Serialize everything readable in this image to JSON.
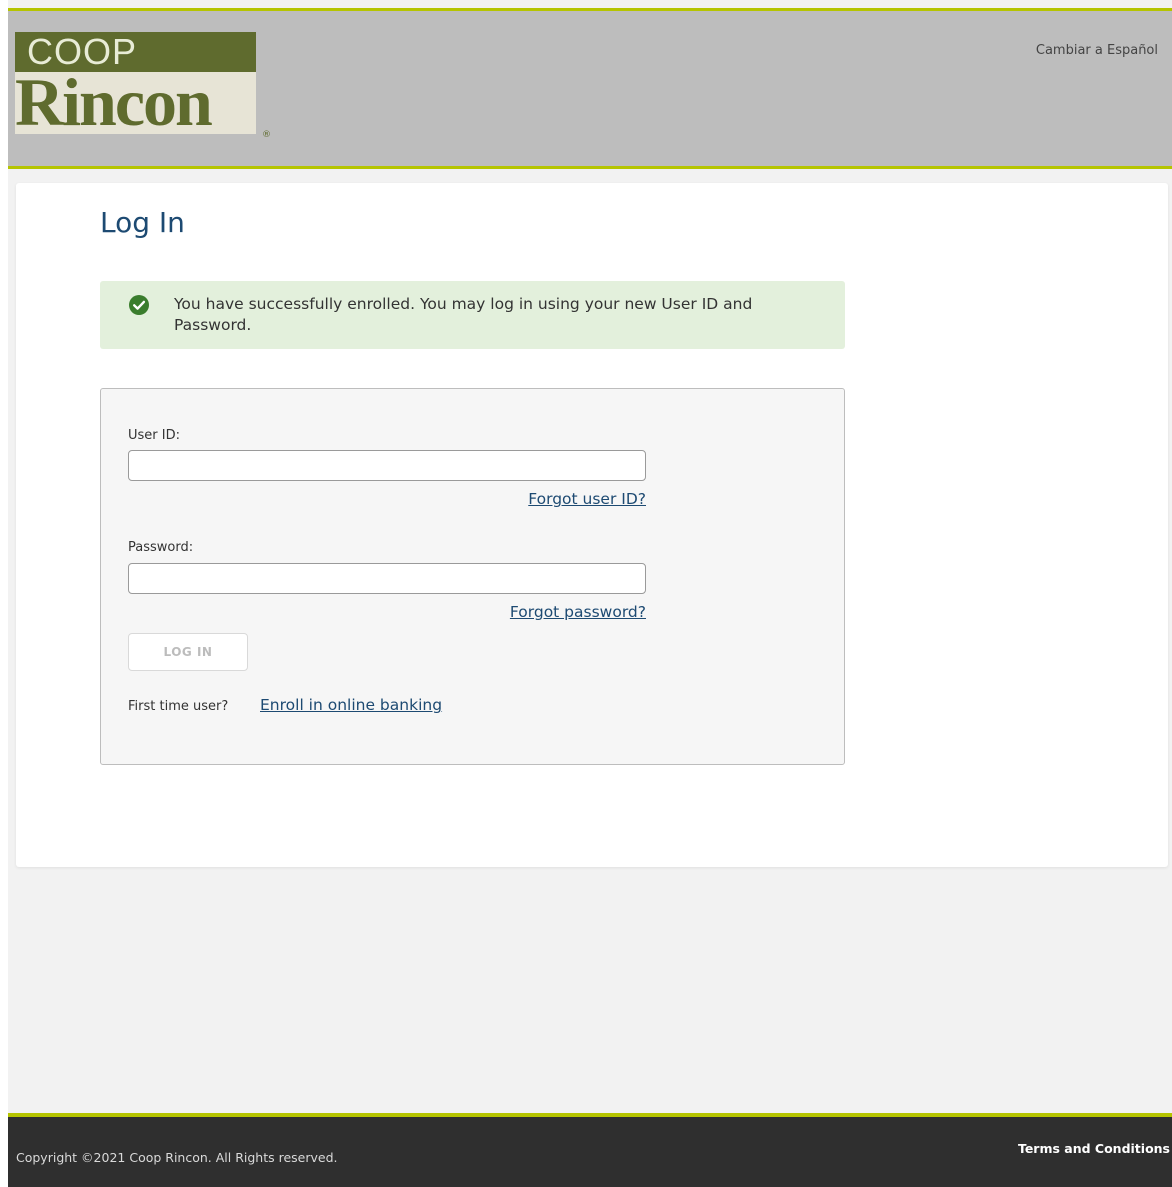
{
  "header": {
    "logo": {
      "top_text": "COOP",
      "bottom_text": "Rincon",
      "registered_mark": "®"
    },
    "language_link": "Cambiar a Español"
  },
  "colors": {
    "accent": "#b5c400",
    "header_bg": "#bdbdbd",
    "logo_green": "#5f6b2e",
    "title_blue": "#1d4a72",
    "success_bg": "#e3f0dc",
    "success_icon": "#3a7d2d",
    "footer_bg": "#2f2f2f"
  },
  "main": {
    "title": "Log In",
    "alert": {
      "icon": "check-circle-icon",
      "message": "You have successfully enrolled. You may log in using your new User ID and Password."
    },
    "login_form": {
      "user_id_label": "User ID:",
      "user_id_value": "",
      "forgot_user_id": "Forgot user ID?",
      "password_label": "Password:",
      "password_value": "",
      "forgot_password": "Forgot password?",
      "login_button": "LOG IN",
      "first_time_text": "First time user?",
      "enroll_link": "Enroll in online banking"
    }
  },
  "footer": {
    "copyright": "Copyright ©2021 Coop Rincon. All Rights reserved.",
    "terms_link": "Terms and Conditions"
  }
}
